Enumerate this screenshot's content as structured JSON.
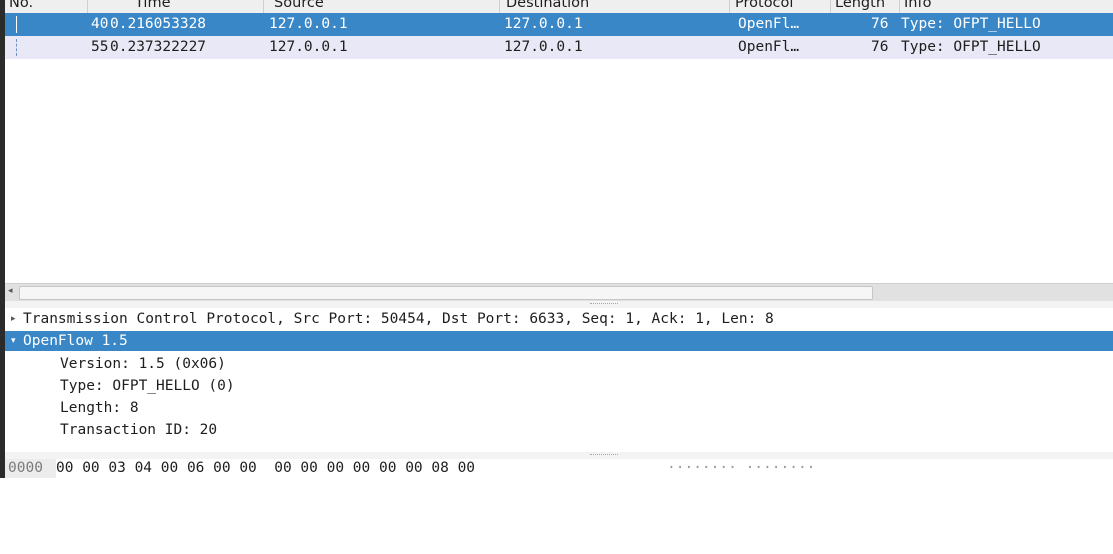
{
  "columns": {
    "no": "No.",
    "time": "Time",
    "source": "Source",
    "destination": "Destination",
    "protocol": "Protocol",
    "length": "Length",
    "info": "Info"
  },
  "packets": [
    {
      "no": "40",
      "time": "0.216053328",
      "source": "127.0.0.1",
      "destination": "127.0.0.1",
      "protocol": "OpenFl…",
      "length": "76",
      "info": "Type: OFPT_HELLO"
    },
    {
      "no": "55",
      "time": "0.237322227",
      "source": "127.0.0.1",
      "destination": "127.0.0.1",
      "protocol": "OpenFl…",
      "length": "76",
      "info": "Type: OFPT_HELLO"
    }
  ],
  "details": {
    "tcp": "Transmission Control Protocol, Src Port: 50454, Dst Port: 6633, Seq: 1, Ack: 1, Len: 8",
    "openflow": "OpenFlow 1.5",
    "version": "Version: 1.5 (0x06)",
    "type": "Type: OFPT_HELLO (0)",
    "length": "Length: 8",
    "xid": "Transaction ID: 20"
  },
  "hex": {
    "offset": "0000",
    "bytes": "00 00 03 04 00 06 00 00  00 00 00 00 00 00 08 00",
    "ascii": "········ ········"
  },
  "icons": {
    "collapsed": "▸",
    "expanded": "▾",
    "scroll_left": "◂"
  },
  "colors": {
    "selection": "#3a87c7",
    "alt_row": "#e9e8f6"
  }
}
